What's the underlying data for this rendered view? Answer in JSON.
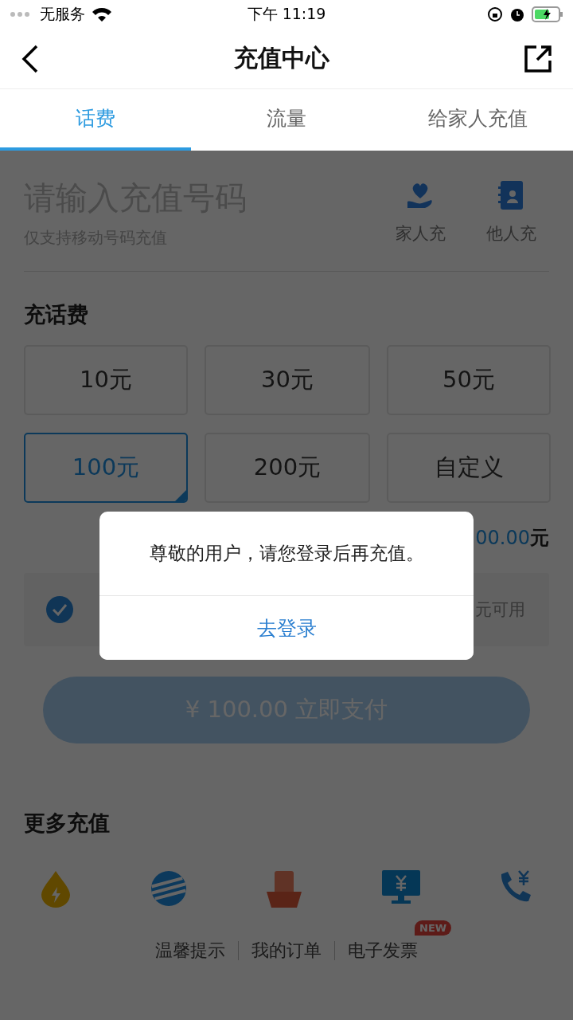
{
  "status_bar": {
    "carrier": "无服务",
    "time": "下午 11:19"
  },
  "nav": {
    "title": "充值中心"
  },
  "tabs": [
    {
      "label": "话费",
      "selected": true
    },
    {
      "label": "流量",
      "selected": false
    },
    {
      "label": "给家人充值",
      "selected": false
    }
  ],
  "recharge": {
    "placeholder": "请输入充值号码",
    "hint": "仅支持移动号码充值",
    "shortcuts": [
      {
        "label": "家人充",
        "kind": "family"
      },
      {
        "label": "他人充",
        "kind": "contact"
      }
    ]
  },
  "amounts": {
    "title": "充话费",
    "options": [
      {
        "label": "10元",
        "selected": false
      },
      {
        "label": "30元",
        "selected": false
      },
      {
        "label": "50元",
        "selected": false
      },
      {
        "label": "100元",
        "selected": true
      },
      {
        "label": "200元",
        "selected": false
      },
      {
        "label": "自定义",
        "selected": false
      }
    ]
  },
  "price": {
    "value": "00.00",
    "unit": "元"
  },
  "coupon": {
    "checked": true,
    "note": "元可用"
  },
  "pay_button": {
    "label": "¥ 100.00  立即支付"
  },
  "more": {
    "title": "更多充值",
    "services": [
      {
        "kind": "drop"
      },
      {
        "kind": "globe"
      },
      {
        "kind": "bill"
      },
      {
        "kind": "monitor"
      },
      {
        "kind": "call"
      }
    ]
  },
  "footer": {
    "links": [
      {
        "label": "温馨提示"
      },
      {
        "label": "我的订单"
      },
      {
        "label": "电子发票",
        "badge": "NEW"
      }
    ]
  },
  "dialog": {
    "message": "尊敬的用户，请您登录后再充值。",
    "action": "去登录"
  }
}
